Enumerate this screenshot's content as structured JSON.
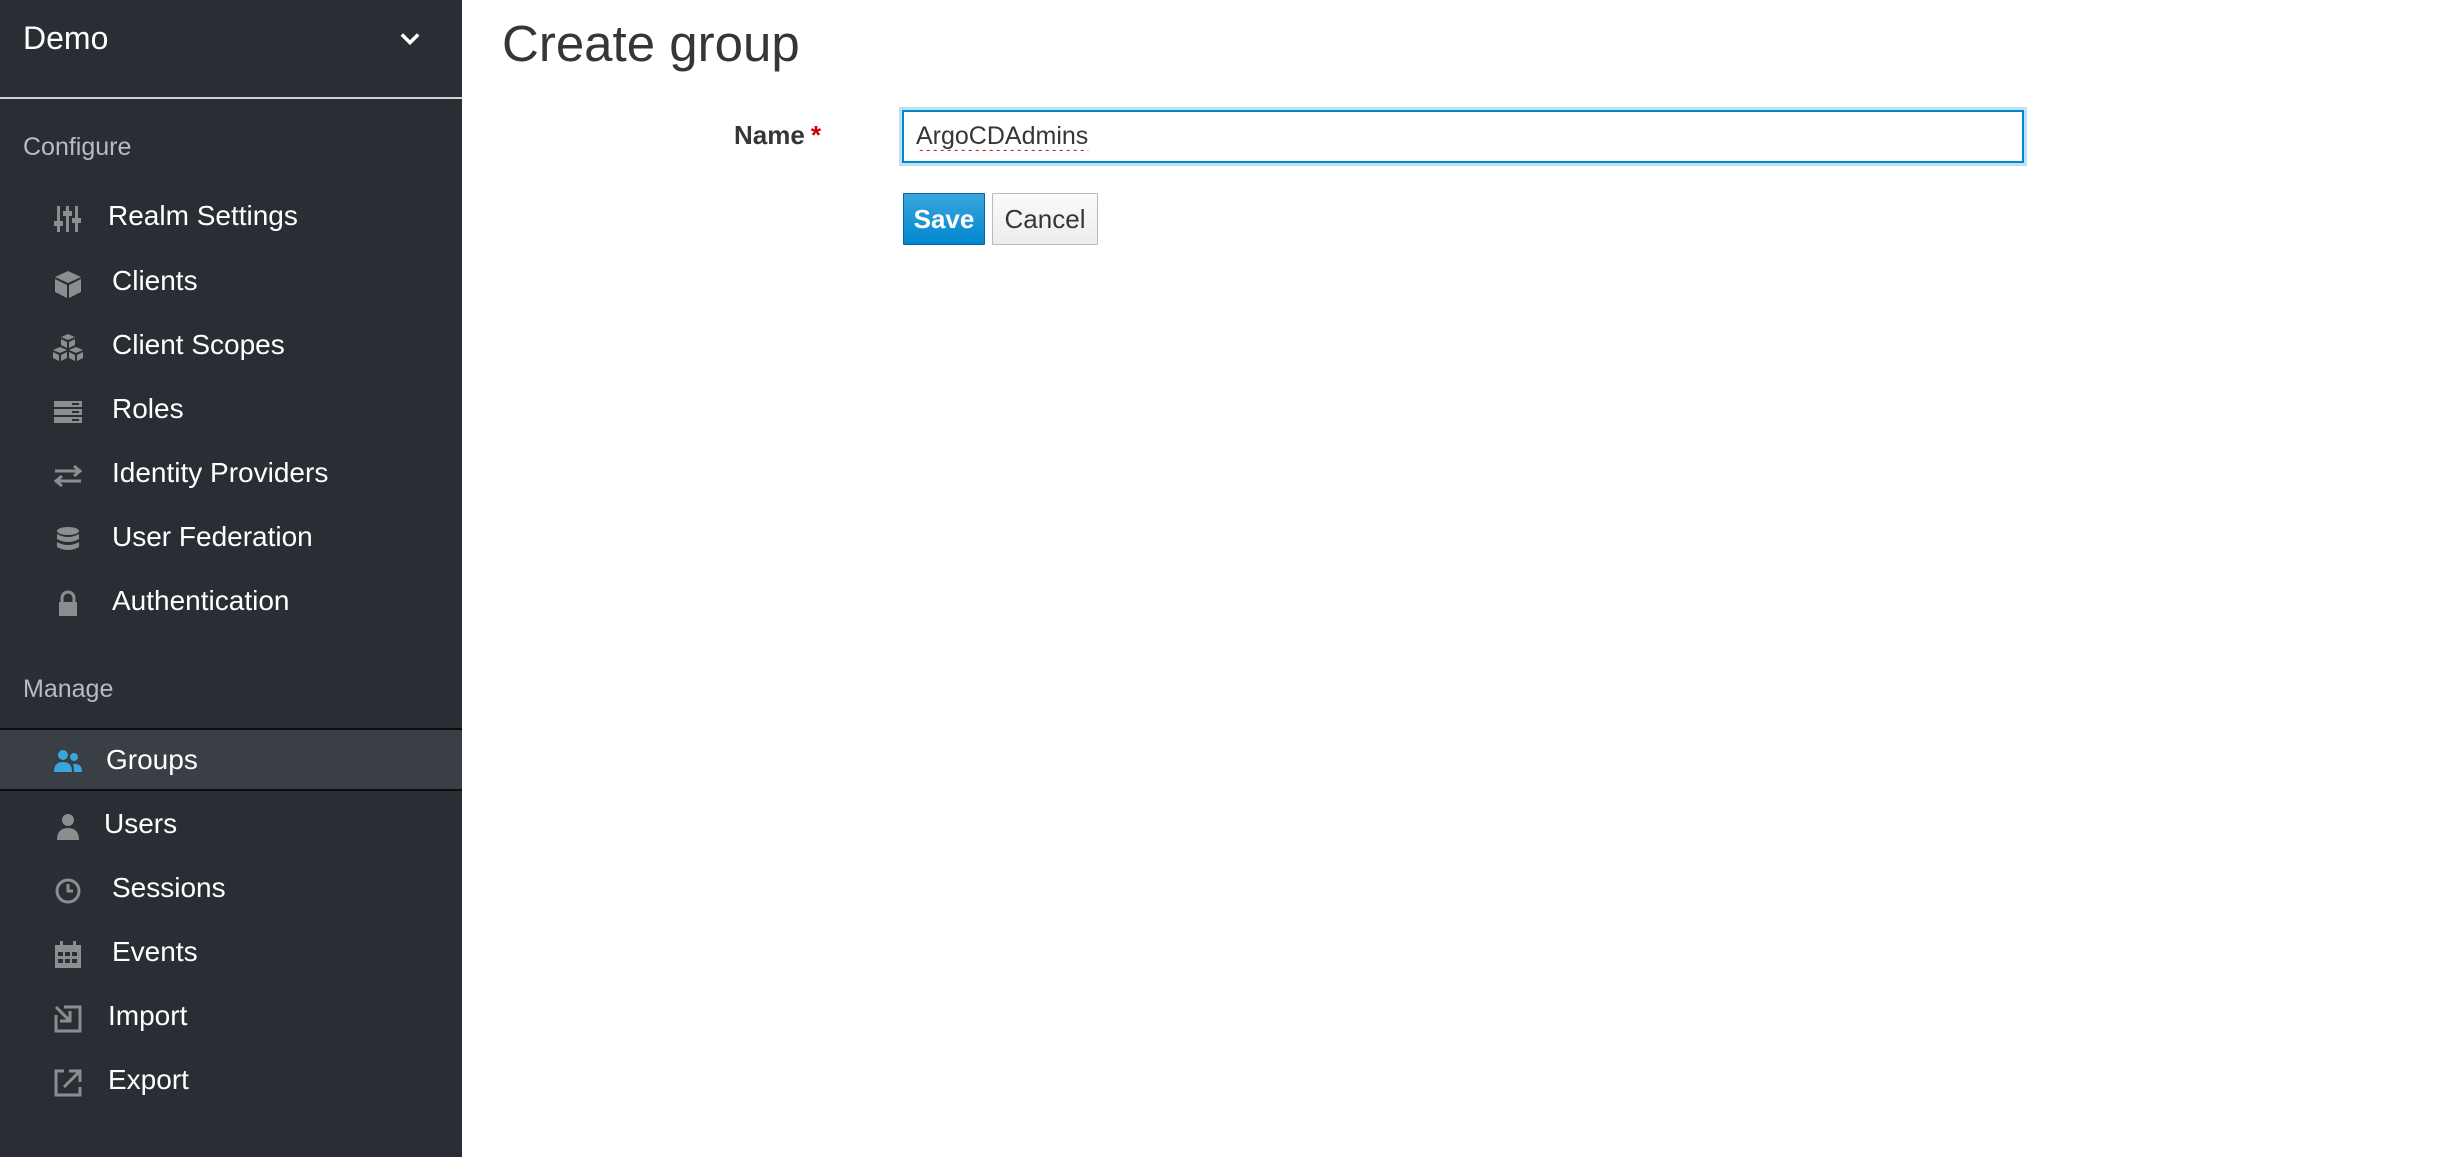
{
  "sidebar": {
    "realm": {
      "name": "Demo",
      "icon": "chevron-down-icon"
    },
    "sections": [
      {
        "title": "Configure"
      },
      {
        "title": "Manage"
      }
    ],
    "configure_items": [
      {
        "label": "Realm Settings",
        "icon": "sliders-icon"
      },
      {
        "label": "Clients",
        "icon": "cube-icon"
      },
      {
        "label": "Client Scopes",
        "icon": "cubes-icon"
      },
      {
        "label": "Roles",
        "icon": "server-icon"
      },
      {
        "label": "Identity Providers",
        "icon": "exchange-icon"
      },
      {
        "label": "User Federation",
        "icon": "database-icon"
      },
      {
        "label": "Authentication",
        "icon": "lock-icon"
      }
    ],
    "manage_items": [
      {
        "label": "Groups",
        "icon": "users-icon",
        "active": true
      },
      {
        "label": "Users",
        "icon": "user-icon"
      },
      {
        "label": "Sessions",
        "icon": "clock-icon"
      },
      {
        "label": "Events",
        "icon": "calendar-icon"
      },
      {
        "label": "Import",
        "icon": "import-icon"
      },
      {
        "label": "Export",
        "icon": "export-icon"
      }
    ]
  },
  "main": {
    "title": "Create group",
    "form": {
      "name_label": "Name",
      "required_mark": "*",
      "name_value": "ArgoCDAdmins",
      "save_label": "Save",
      "cancel_label": "Cancel"
    }
  },
  "colors": {
    "sidebar_bg": "#292e34",
    "active_item_bg": "#393f44",
    "primary": "#0088ce",
    "active_icon": "#39a5dc",
    "icon_gray": "#8b8d8f"
  }
}
